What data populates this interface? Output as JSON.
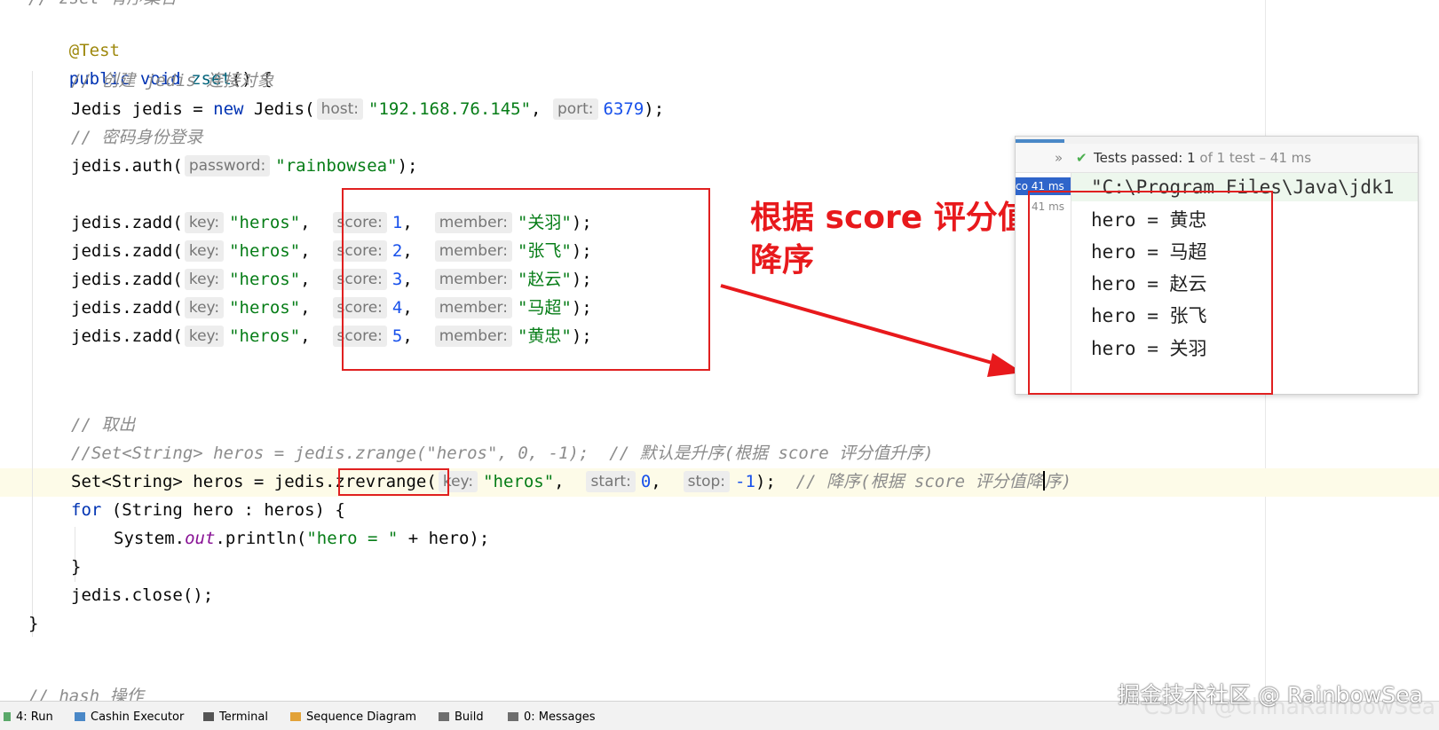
{
  "editor": {
    "top_partial": "// zset 有序集合",
    "annotation": "@Test",
    "method": {
      "modifiers": "public void",
      "name": "zset",
      "rest": "() {"
    },
    "c_create": "// 创建 jedis 连接对象",
    "jedis_new": {
      "pre": "Jedis jedis = ",
      "kw": "new",
      "cls": " Jedis(",
      "hint_host": "host:",
      "host": "\"192.168.76.145\"",
      "comma": ",",
      "hint_port": "port:",
      "port": "6379",
      "end": ");"
    },
    "c_auth": "// 密码身份登录",
    "auth": {
      "pre": "jedis.auth(",
      "hint": "password:",
      "val": "\"rainbowsea\"",
      "end": ");"
    },
    "zadd_prefix": "jedis.zadd(",
    "hint_key": "key:",
    "hint_score": "score:",
    "hint_member": "member:",
    "zadd": [
      {
        "key": "\"heros\"",
        "score": "1",
        "member": "\"关羽\""
      },
      {
        "key": "\"heros\"",
        "score": "2",
        "member": "\"张飞\""
      },
      {
        "key": "\"heros\"",
        "score": "3",
        "member": "\"赵云\""
      },
      {
        "key": "\"heros\"",
        "score": "4",
        "member": "\"马超\""
      },
      {
        "key": "\"heros\"",
        "score": "5",
        "member": "\"黄忠\""
      }
    ],
    "c_fetch": "// 取出",
    "c_zrange": "//Set<String> heros = jedis.zrange(\"heros\", 0, -1);  // 默认是升序(根据 score 评分值升序)",
    "zrev": {
      "pre": "Set<String> heros = jedis",
      "method": ".zrevrange(",
      "hint_key": "key:",
      "key": "\"heros\"",
      "hint_start": "start:",
      "start": "0",
      "hint_stop": "stop:",
      "stop": "-1",
      "end": ");",
      "comment_a": "// 降序(根据 score 评分值降",
      "comment_b": "序)"
    },
    "for_line": {
      "kw": "for",
      "rest": " (String hero : heros) {"
    },
    "println": {
      "pre": "System.",
      "field": "out",
      "mid": ".println(",
      "str": "\"hero = \"",
      "rest": " + hero);"
    },
    "close_brace": "}",
    "close_call": "jedis.close();",
    "end_brace": "}",
    "bottom_partial": "// hash 操作"
  },
  "annotation_label": {
    "line1": "根据 score 评分值",
    "line2": "降序"
  },
  "test_panel": {
    "chevron": "»",
    "check": "✔",
    "status_bold": "Tests passed:",
    "status_count": "1",
    "status_rest": "of 1 test – 41 ms",
    "tree_selected": "co 41 ms",
    "tree_child": "41 ms",
    "command": "\"C:\\Program Files\\Java\\jdk1",
    "output": [
      "hero = 黄忠",
      "hero = 马超",
      "hero = 赵云",
      "hero = 张飞",
      "hero = 关羽"
    ]
  },
  "tool_windows": [
    {
      "label": "4: Run",
      "icon": "run-icon"
    },
    {
      "label": "Cashin Executor",
      "icon": "executor-icon"
    },
    {
      "label": "Terminal",
      "icon": "terminal-icon"
    },
    {
      "label": "Sequence Diagram",
      "icon": "sequence-diagram-icon"
    },
    {
      "label": "Build",
      "icon": "build-icon"
    },
    {
      "label": "0: Messages",
      "icon": "messages-icon"
    }
  ],
  "watermark": "掘金技术社区 @ RainbowSea",
  "watermark_back": "CSDN @ChinaRainbowSea",
  "colors": {
    "keyword": "#0033b3",
    "string": "#067d17",
    "number": "#1750eb",
    "annotation_red": "#e02020",
    "test_pass_green": "#4caf50"
  }
}
